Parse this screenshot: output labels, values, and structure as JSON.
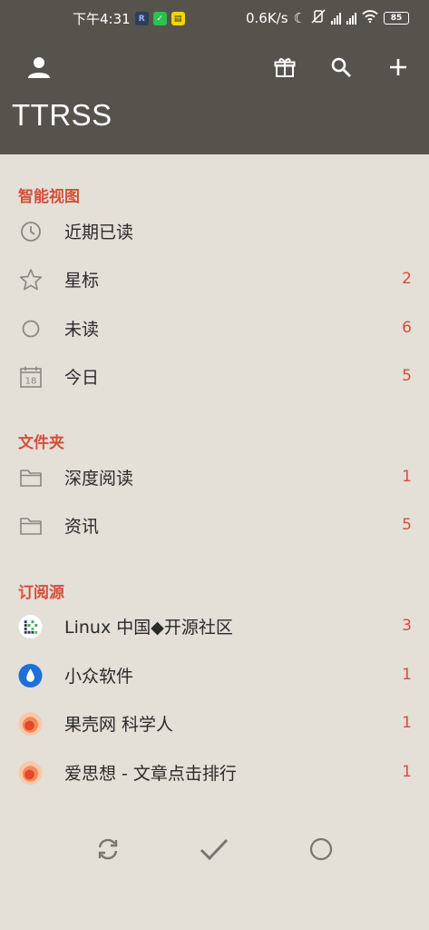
{
  "status_bar": {
    "time": "下午4:31",
    "badge_r": "R",
    "badge_wx": "✓",
    "badge_y": "▤",
    "net_speed": "0.6K/s",
    "moon": "☾",
    "battery": "85"
  },
  "app_bar": {
    "title": "TTRSS"
  },
  "sections": {
    "smart": {
      "header": "智能视图",
      "items": [
        {
          "label": "近期已读",
          "count": ""
        },
        {
          "label": "星标",
          "count": "2"
        },
        {
          "label": "未读",
          "count": "6"
        },
        {
          "label": "今日",
          "count": "5",
          "calendar_day": "18"
        }
      ]
    },
    "folders": {
      "header": "文件夹",
      "items": [
        {
          "label": "深度阅读",
          "count": "1"
        },
        {
          "label": "资讯",
          "count": "5"
        }
      ]
    },
    "feeds": {
      "header": "订阅源",
      "items": [
        {
          "label": "Linux 中国◆开源社区",
          "count": "3"
        },
        {
          "label": "小众软件",
          "count": "1"
        },
        {
          "label": "果壳网 科学人",
          "count": "1"
        },
        {
          "label": "爱思想 - 文章点击排行",
          "count": "1"
        }
      ]
    }
  },
  "colors": {
    "app_bar": "#56534c",
    "background": "#e4dfd7",
    "accent": "#d2503c",
    "icon": "#8a8782",
    "bottom_icon": "#78756f"
  },
  "icons": [
    "person-icon",
    "gift-icon",
    "search-icon",
    "add-icon",
    "clock-icon",
    "star-icon",
    "circle-icon",
    "calendar-icon",
    "folder-icon",
    "refresh-icon",
    "check-icon"
  ]
}
